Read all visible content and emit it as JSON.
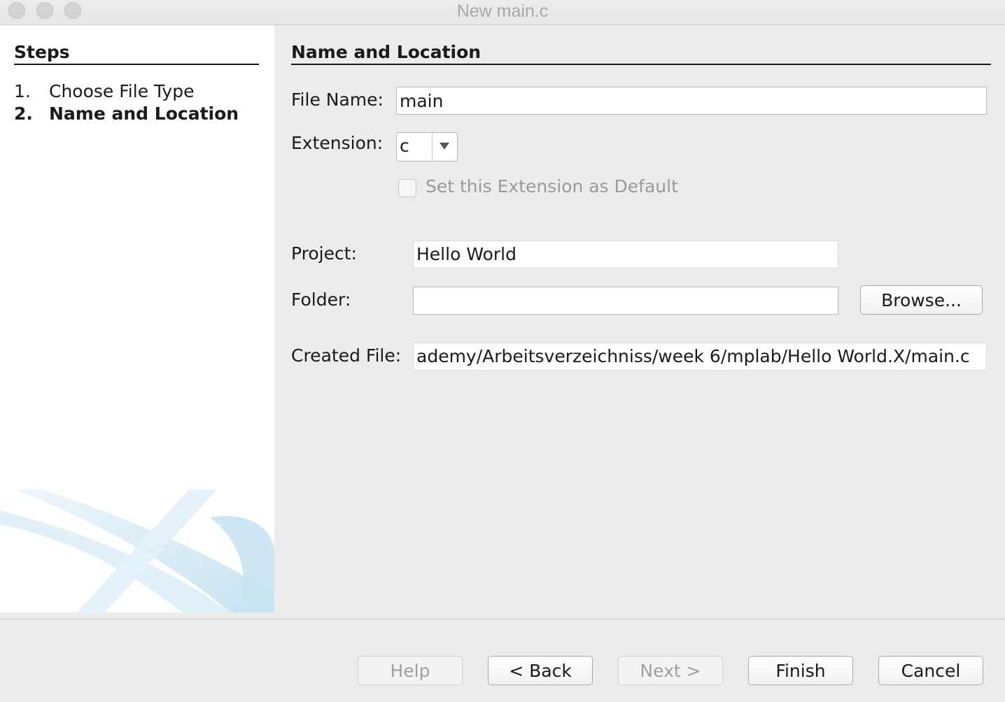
{
  "window": {
    "title": "New main.c"
  },
  "steps": {
    "title": "Steps",
    "items": [
      {
        "num": "1.",
        "label": "Choose File Type"
      },
      {
        "num": "2.",
        "label": "Name and Location"
      }
    ]
  },
  "main": {
    "section_title": "Name and Location",
    "file_name_label": "File Name:",
    "file_name_value": "main",
    "extension_label": "Extension:",
    "extension_value": "c",
    "default_checkbox_label": "Set this Extension as Default",
    "default_checkbox_checked": false,
    "project_label": "Project:",
    "project_value": "Hello World",
    "folder_label": "Folder:",
    "folder_value": "",
    "browse_label": "Browse...",
    "created_file_label": "Created File:",
    "created_file_value": "ademy/Arbeitsverzeichniss/week 6/mplab/Hello World.X/main.c"
  },
  "footer": {
    "help_label": "Help",
    "back_label": "< Back",
    "next_label": "Next >",
    "finish_label": "Finish",
    "cancel_label": "Cancel"
  },
  "icons": {
    "window_controls": [
      "close-icon",
      "minimize-icon",
      "maximize-icon"
    ],
    "combo_arrow": "chevron-down-icon"
  }
}
